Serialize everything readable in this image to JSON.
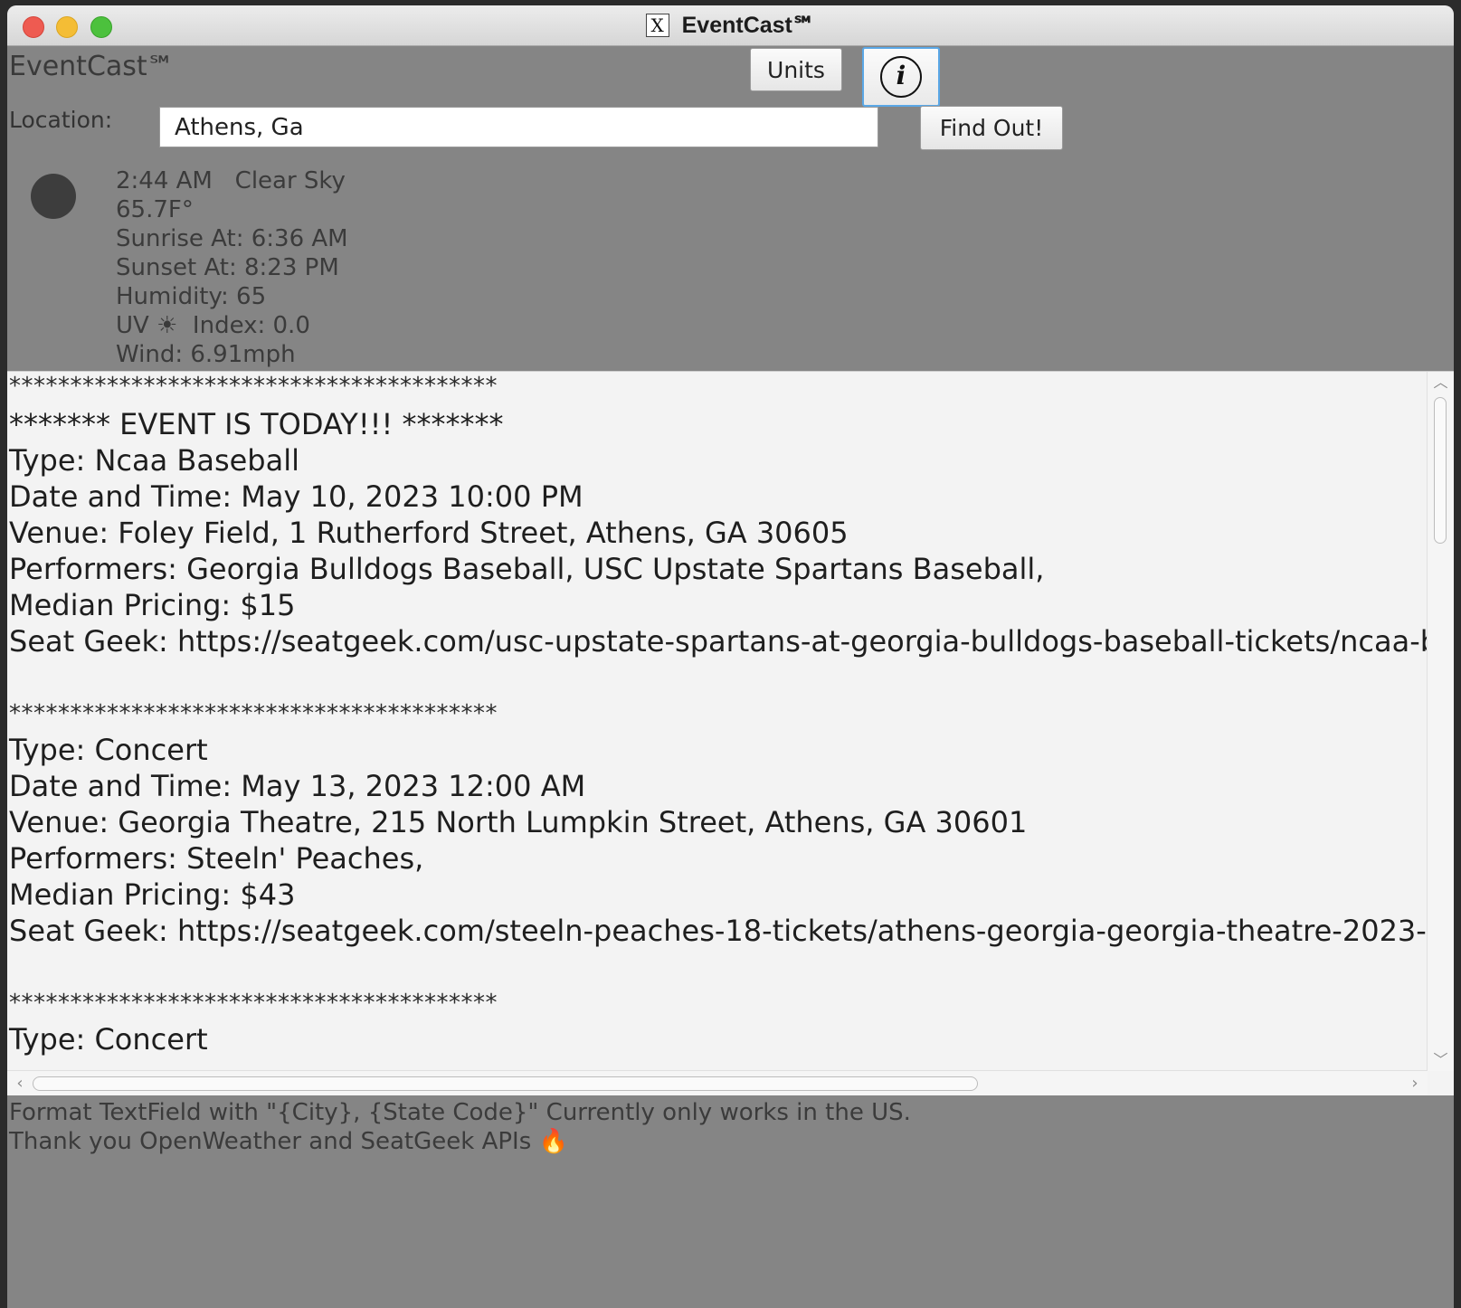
{
  "window": {
    "title": "EventCast℠"
  },
  "header": {
    "app_title": "EventCast℠",
    "units_label": "Units",
    "info_glyph": "i"
  },
  "search": {
    "location_label": "Location:",
    "location_value": "Athens, Ga",
    "submit_label": "Find Out!"
  },
  "weather": {
    "icon": "moon-icon",
    "time_condition": "2:44 AM   Clear Sky",
    "temperature": "65.7F°",
    "sunrise": "Sunrise At: 6:36 AM",
    "sunset": "Sunset At: 8:23 PM",
    "humidity": "Humidity: 65",
    "uv": "UV ☀  Index: 0.0",
    "wind": "Wind: 6.91mph"
  },
  "events": {
    "separator": "****************************************",
    "items": [
      {
        "today_banner": "******* EVENT IS TODAY!!! *******",
        "type": "Type: Ncaa Baseball",
        "datetime": "Date and Time: May 10, 2023 10:00 PM",
        "venue": "Venue: Foley Field, 1 Rutherford Street, Athens, GA 30605",
        "performers": "Performers: Georgia Bulldogs Baseball, USC Upstate Spartans Baseball,",
        "pricing": "Median Pricing: $15",
        "link": "Seat Geek: https://seatgeek.com/usc-upstate-spartans-at-georgia-bulldogs-baseball-tickets/ncaa-b"
      },
      {
        "type": "Type: Concert",
        "datetime": "Date and Time: May 13, 2023 12:00 AM",
        "venue": "Venue: Georgia Theatre, 215 North Lumpkin Street, Athens, GA 30601",
        "performers": "Performers: Steeln' Peaches,",
        "pricing": "Median Pricing: $43",
        "link": "Seat Geek: https://seatgeek.com/steeln-peaches-18-tickets/athens-georgia-georgia-theatre-2023-"
      },
      {
        "type": "Type: Concert"
      }
    ]
  },
  "footer": {
    "format_hint": "Format TextField with \"{City}, {State Code}\" Currently only works in the US.",
    "credits": "Thank you OpenWeather and SeatGeek APIs 🔥"
  },
  "colors": {
    "window_bg": "#858585",
    "events_bg": "#f3f3f3",
    "focus_ring": "#5aa7e6"
  }
}
